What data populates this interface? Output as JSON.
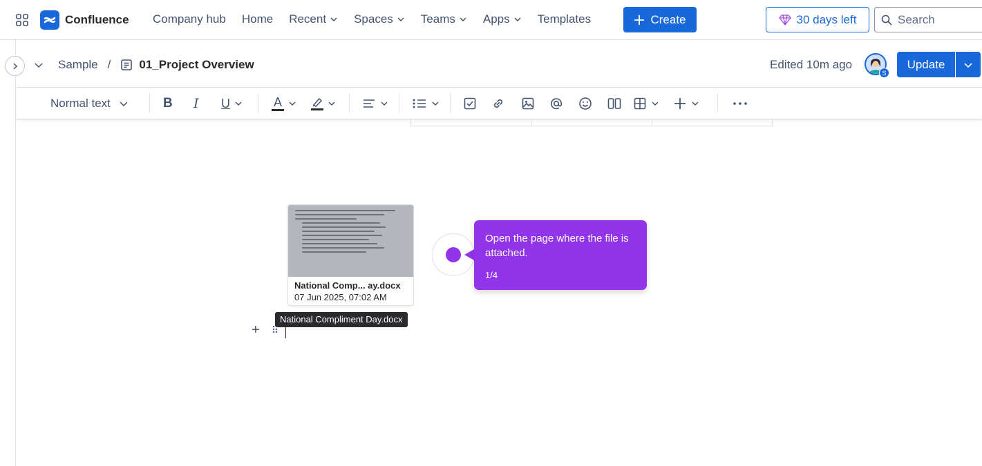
{
  "topbar": {
    "brand": "Confluence",
    "nav": [
      {
        "label": "Company hub",
        "dropdown": false
      },
      {
        "label": "Home",
        "dropdown": false
      },
      {
        "label": "Recent",
        "dropdown": true
      },
      {
        "label": "Spaces",
        "dropdown": true
      },
      {
        "label": "Teams",
        "dropdown": true
      },
      {
        "label": "Apps",
        "dropdown": true
      },
      {
        "label": "Templates",
        "dropdown": false
      }
    ],
    "create_label": "Create",
    "trial_label": "30 days left",
    "search_placeholder": "Search"
  },
  "subheader": {
    "breadcrumb_space": "Sample",
    "breadcrumb_sep": "/",
    "breadcrumb_page": "01_Project Overview",
    "edited": "Edited 10m ago",
    "avatar_badge": "S",
    "update_label": "Update"
  },
  "toolbar": {
    "text_style": "Normal text",
    "bold": "B",
    "italic": "I",
    "underline": "U",
    "text_color": "A"
  },
  "attachment": {
    "name_short": "National Comp... ay.docx",
    "date": "07 Jun 2025, 07:02 AM",
    "tooltip": "National Compliment Day.docx"
  },
  "guide": {
    "text": "Open the page where the file is attached.",
    "step": "1/4"
  },
  "colors": {
    "primary": "#1868db",
    "guide": "#9234ea"
  }
}
